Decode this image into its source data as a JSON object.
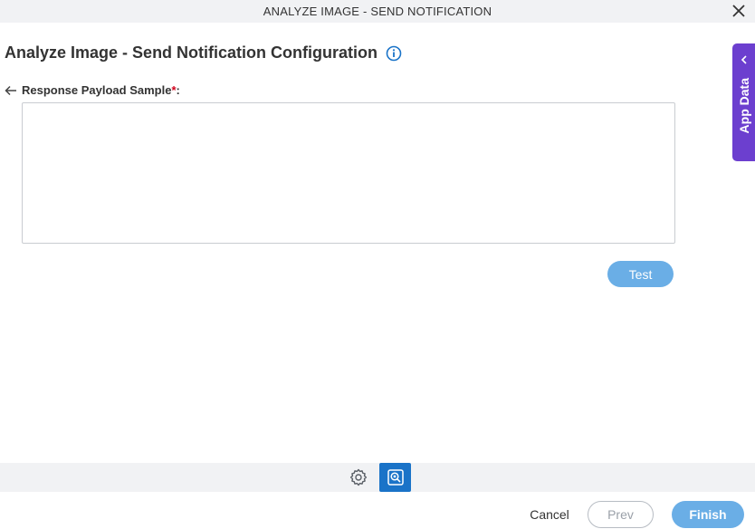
{
  "window": {
    "title": "ANALYZE IMAGE - SEND NOTIFICATION",
    "close_icon": "close-icon"
  },
  "header": {
    "title": "Analyze Image - Send Notification Configuration",
    "info_icon": "info-icon"
  },
  "form": {
    "payload_label": "Response Payload Sample",
    "required_mark": "*",
    "label_suffix": ":",
    "payload_value": "",
    "test_label": "Test"
  },
  "side_tab": {
    "label": "App Data",
    "chevron_icon": "chevron-left-icon"
  },
  "toolbar": {
    "settings_icon": "gear-icon",
    "preview_icon": "preview-icon"
  },
  "footer": {
    "cancel_label": "Cancel",
    "prev_label": "Prev",
    "finish_label": "Finish"
  },
  "colors": {
    "accent": "#1a73c8",
    "button_light": "#6aaee6",
    "side_tab": "#6c3fcf",
    "required": "#d0021b"
  }
}
